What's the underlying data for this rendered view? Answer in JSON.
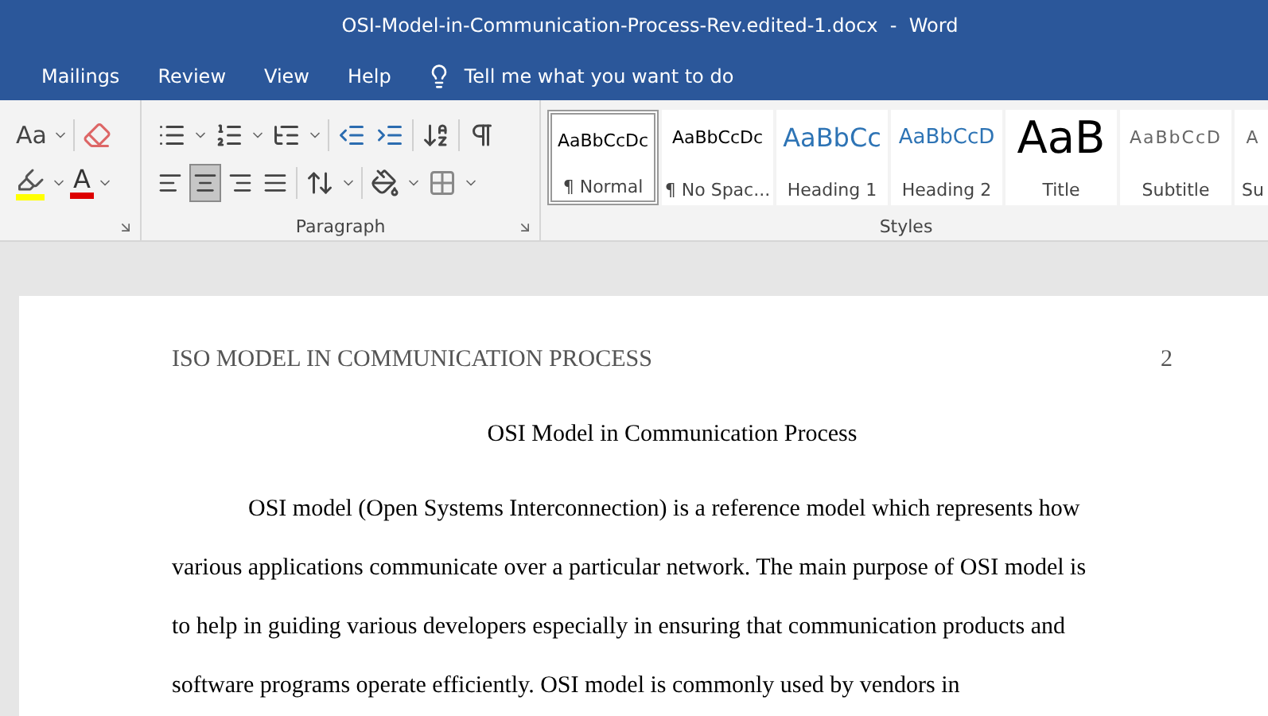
{
  "window": {
    "title": "OSI-Model-in-Communication-Process-Rev.edited-1.docx  -  Word"
  },
  "tabs": [
    {
      "label": "Mailings",
      "selected": false
    },
    {
      "label": "Review",
      "selected": false
    },
    {
      "label": "View",
      "selected": false
    },
    {
      "label": "Help",
      "selected": false
    }
  ],
  "tell_me": {
    "placeholder": "Tell me what you want to do"
  },
  "font_group": {
    "change_case": "Aa",
    "font_color": "A"
  },
  "paragraph_group": {
    "label": "Paragraph",
    "alignments": [
      {
        "kind": "left",
        "selected": false
      },
      {
        "kind": "center",
        "selected": true
      },
      {
        "kind": "right",
        "selected": false
      },
      {
        "kind": "justify",
        "selected": false
      }
    ]
  },
  "styles_group": {
    "label": "Styles",
    "items": [
      {
        "kind": "body",
        "preview": "AaBbCcDc",
        "label": "¶ Normal",
        "selected": true
      },
      {
        "kind": "body",
        "preview": "AaBbCcDc",
        "label": "¶ No Spac...",
        "selected": false
      },
      {
        "kind": "heading1",
        "preview": "AaBbCc",
        "label": "Heading 1",
        "selected": false
      },
      {
        "kind": "heading2",
        "preview": "AaBbCcD",
        "label": "Heading 2",
        "selected": false
      },
      {
        "kind": "title",
        "preview": "AaB",
        "label": "Title",
        "selected": false
      },
      {
        "kind": "subtitle",
        "preview": "AaBbCcD",
        "label": "Subtitle",
        "selected": false
      },
      {
        "kind": "subtitle",
        "preview": "A",
        "label": "Su",
        "selected": false
      }
    ]
  },
  "document": {
    "header": "ISO MODEL IN COMMUNICATION PROCESS",
    "page_number": "2",
    "title": "OSI Model in Communication Process",
    "lines": [
      "OSI model (Open Systems Interconnection) is a reference model which represents how",
      "various applications communicate over a particular network. The main purpose of OSI model is",
      "to help in guiding various developers especially in ensuring that communication products and",
      "software programs operate efficiently. OSI model is commonly used by vendors in"
    ]
  }
}
